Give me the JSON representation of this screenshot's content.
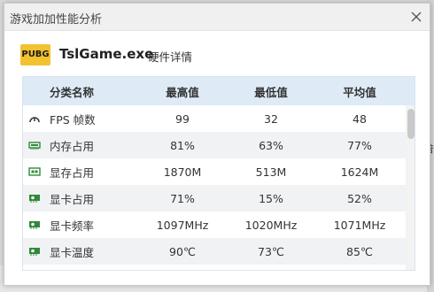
{
  "window": {
    "title": "游戏加加性能分析"
  },
  "app": {
    "logo_text": "PUBG",
    "exe_name": "TslGame.exe",
    "detail_link": "硬件详情"
  },
  "table": {
    "headers": [
      "分类名称",
      "最高值",
      "最低值",
      "平均值"
    ],
    "rows": [
      {
        "icon": "gauge-icon",
        "name": "FPS 帧数",
        "max": "99",
        "min": "32",
        "avg": "48"
      },
      {
        "icon": "memory-icon",
        "name": "内存占用",
        "max": "81%",
        "min": "63%",
        "avg": "77%"
      },
      {
        "icon": "vram-icon",
        "name": "显存占用",
        "max": "1870M",
        "min": "513M",
        "avg": "1624M"
      },
      {
        "icon": "gpu-card-icon",
        "name": "显卡占用",
        "max": "71%",
        "min": "15%",
        "avg": "52%"
      },
      {
        "icon": "gpu-card-icon",
        "name": "显卡频率",
        "max": "1097MHz",
        "min": "1020MHz",
        "avg": "1071MHz"
      },
      {
        "icon": "gpu-card-icon",
        "name": "显卡温度",
        "max": "90℃",
        "min": "73℃",
        "avg": "85℃"
      }
    ]
  },
  "background": {
    "edge_char": "普"
  },
  "colors": {
    "header_bg": "#deebf7",
    "icon_green": "#2f8a3a",
    "logo_yellow": "#f2c230"
  }
}
